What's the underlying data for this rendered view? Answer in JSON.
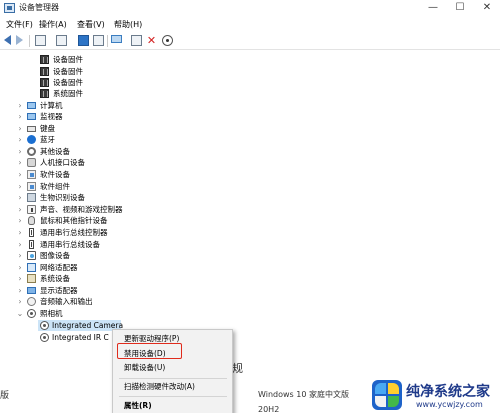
{
  "window": {
    "title": "设备管理器",
    "minimize": "—",
    "maximize": "☐",
    "close": "✕"
  },
  "menu": [
    "文件(F)",
    "操作(A)",
    "查看(V)",
    "帮助(H)"
  ],
  "toolbar": [
    "back-icon",
    "forward-icon",
    "properties-icon",
    "device-list-icon",
    "help-icon",
    "details-icon",
    "scan-monitor-icon",
    "update-driver-icon",
    "uninstall-icon",
    "enable-icon"
  ],
  "tree": {
    "firmware_children": [
      "设备固件",
      "设备固件",
      "设备固件",
      "系统固件"
    ],
    "categories": [
      "计算机",
      "监视器",
      "键盘",
      "蓝牙",
      "其他设备",
      "人机接口设备",
      "软件设备",
      "软件组件",
      "生物识别设备",
      "声音、视频和游戏控制器",
      "鼠标和其他指针设备",
      "通用串行总线控制器",
      "通用串行总线设备",
      "图像设备",
      "网络适配器",
      "系统设备",
      "显示适配器",
      "音频输入和输出",
      "照相机"
    ],
    "camera_children": [
      "Integrated Camera",
      "Integrated IR C"
    ]
  },
  "context_menu": {
    "items": [
      "更新驱动程序(P)",
      "禁用设备(D)",
      "卸载设备(U)",
      "扫描检测硬件改动(A)",
      "属性(R)"
    ],
    "highlighted": "禁用设备(D)"
  },
  "background": {
    "left_text": "版",
    "mid_text": "规",
    "right_line1": "Windows 10 家庭中文版",
    "right_line2": "20H2"
  },
  "watermark": {
    "name": "纯净系统之家",
    "url": "www.ycwjzy.com"
  },
  "colors": {
    "highlight_border": "#e02b1c",
    "selection": "#cce4f7"
  }
}
